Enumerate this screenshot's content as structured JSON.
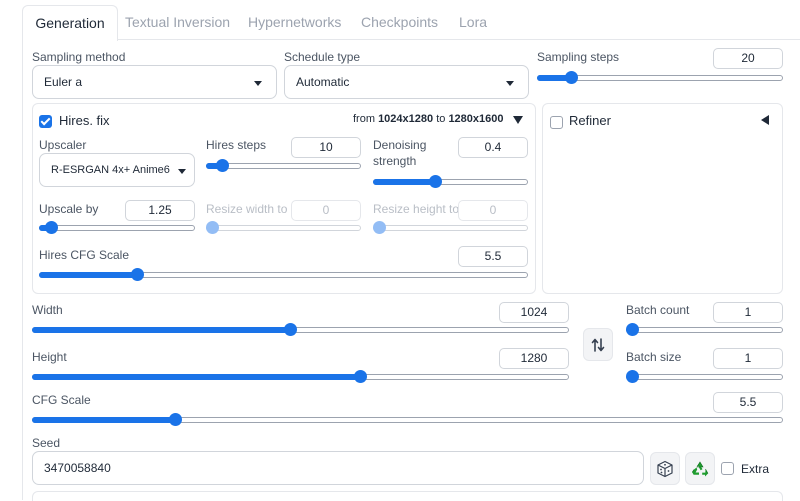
{
  "tabs": [
    "Generation",
    "Textual Inversion",
    "Hypernetworks",
    "Checkpoints",
    "Lora"
  ],
  "sampling_method": {
    "label": "Sampling method",
    "value": "Euler a"
  },
  "schedule_type": {
    "label": "Schedule type",
    "value": "Automatic"
  },
  "sampling_steps": {
    "label": "Sampling steps",
    "value": "20",
    "fraction": 0.14
  },
  "hires": {
    "label": "Hires. fix",
    "checked": true,
    "from_prefix": "from",
    "from_size": "1024x1280",
    "to_prefix": "to",
    "to_size": "1280x1600",
    "collapse_icon": "triangle-down-icon",
    "upscaler": {
      "label": "Upscaler",
      "value": "R-ESRGAN 4x+ Anime6"
    },
    "steps": {
      "label": "Hires steps",
      "value": "10",
      "fraction": 0.1
    },
    "denoising": {
      "label_line1": "Denoising",
      "label_line2": "strength",
      "value": "0.4",
      "fraction": 0.4
    },
    "upscale_by": {
      "label": "Upscale by",
      "value": "1.25",
      "fraction": 0.08
    },
    "resize_width": {
      "label": "Resize width to",
      "value": "0",
      "fraction": 0.0
    },
    "resize_height": {
      "label": "Resize height to",
      "value": "0",
      "fraction": 0.0
    },
    "cfg": {
      "label": "Hires CFG Scale",
      "value": "5.5",
      "fraction": 0.2
    }
  },
  "refiner": {
    "label": "Refiner",
    "checked": false,
    "collapse_icon": "triangle-left-icon"
  },
  "width": {
    "label": "Width",
    "value": "1024",
    "fraction": 0.48
  },
  "height": {
    "label": "Height",
    "value": "1280",
    "fraction": 0.61
  },
  "swap_icon": "swap-arrows-icon",
  "batch_count": {
    "label": "Batch count",
    "value": "1",
    "fraction": 0.0
  },
  "batch_size": {
    "label": "Batch size",
    "value": "1",
    "fraction": 0.0
  },
  "cfg_scale": {
    "label": "CFG Scale",
    "value": "5.5",
    "fraction": 0.19
  },
  "seed": {
    "label": "Seed",
    "value": "3470058840",
    "dice_icon": "dice-icon",
    "recycle_icon": "recycle-icon"
  },
  "extra": {
    "label": "Extra",
    "checked": false
  },
  "colors": {
    "accent": "#1a73e8",
    "recycle": "#1f9d2f"
  }
}
